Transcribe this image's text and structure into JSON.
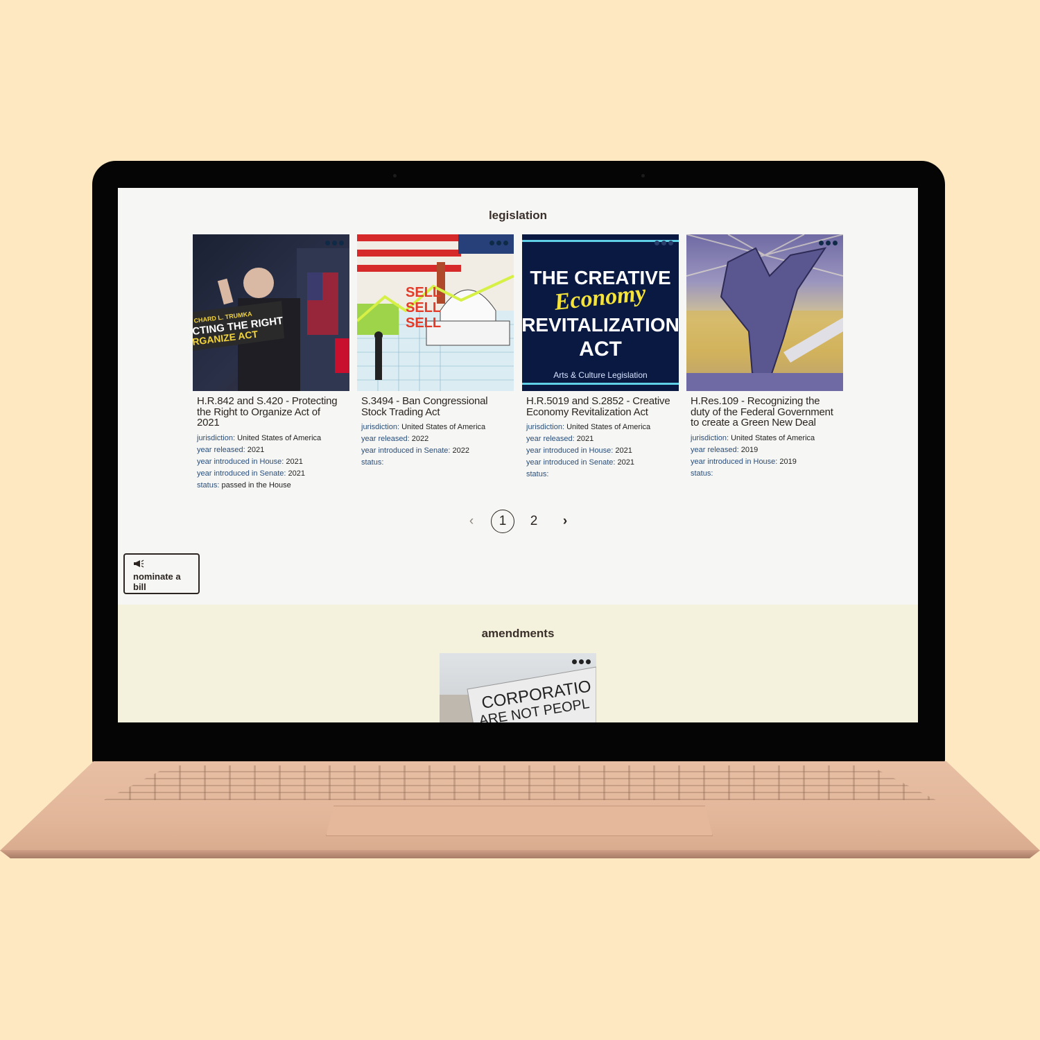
{
  "legislation": {
    "title": "legislation",
    "cards": [
      {
        "title": "H.R.842 and S.420 - Protecting the Right to Organize Act of 2021",
        "image_text": [
          "CHARD L. TRUMKA",
          "CTING THE RIGHT",
          "RGANIZE ACT"
        ],
        "meta": [
          {
            "k": "jurisdiction:",
            "v": " United States of America"
          },
          {
            "k": "year released:",
            "v": " 2021"
          },
          {
            "k": "year introduced in House:",
            "v": " 2021"
          },
          {
            "k": "year introduced in Senate:",
            "v": " 2021"
          },
          {
            "k": "status:",
            "v": " passed in the House"
          }
        ]
      },
      {
        "title": "S.3494 - Ban Congressional Stock Trading Act",
        "image_text": [
          "SELL",
          "SELL",
          "SELL"
        ],
        "meta": [
          {
            "k": "jurisdiction:",
            "v": " United States of America"
          },
          {
            "k": "year released:",
            "v": " 2022"
          },
          {
            "k": "year introduced in Senate:",
            "v": " 2022"
          },
          {
            "k": "status:",
            "v": ""
          }
        ]
      },
      {
        "title": "H.R.5019 and S.2852 - Creative Economy Revitalization Act",
        "image_text": [
          "THE CREATIVE",
          "Economy",
          "REVITALIZATION",
          "ACT",
          "Arts & Culture Legislation"
        ],
        "meta": [
          {
            "k": "jurisdiction:",
            "v": " United States of America"
          },
          {
            "k": "year released:",
            "v": " 2021"
          },
          {
            "k": "year introduced in House:",
            "v": " 2021"
          },
          {
            "k": "year introduced in Senate:",
            "v": " 2021"
          },
          {
            "k": "status:",
            "v": ""
          }
        ]
      },
      {
        "title": "H.Res.109 - Recognizing the duty of the Federal Government to create a Green New Deal",
        "image_text": [],
        "meta": [
          {
            "k": "jurisdiction:",
            "v": " United States of America"
          },
          {
            "k": "year released:",
            "v": " 2019"
          },
          {
            "k": "year introduced in House:",
            "v": " 2019"
          },
          {
            "k": "status:",
            "v": ""
          }
        ]
      }
    ]
  },
  "pagination": {
    "prev": "‹",
    "pages": [
      "1",
      "2"
    ],
    "current": "1",
    "next": "›"
  },
  "nominate": {
    "label": "nominate a bill",
    "icon": "megaphone-icon"
  },
  "amendments": {
    "title": "amendments",
    "image_text": [
      "CORPORATIO",
      "ARE NOT PEOPL"
    ]
  },
  "colors": {
    "background": "#fde8c2",
    "screen": "#f6f7f4",
    "amendments_bg": "#f4f2dc",
    "meta_key": "#2a4d7a"
  }
}
